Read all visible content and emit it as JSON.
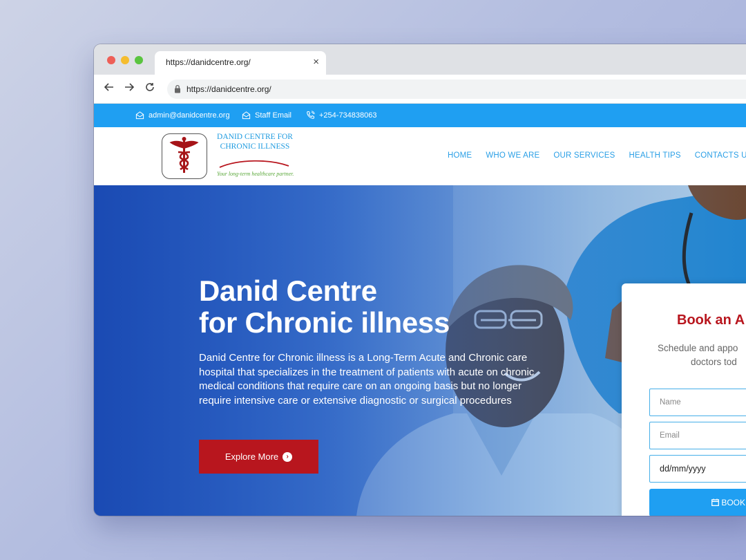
{
  "browser": {
    "tab_title": "https://danidcentre.org/",
    "tab_close": "×",
    "url": "https://danidcentre.org/"
  },
  "topbar": {
    "email": "admin@danidcentre.org",
    "staff_email": "Staff Email",
    "phone": "+254-734838063"
  },
  "logo": {
    "name_line1": "DANID CENTRE FOR",
    "name_line2": "CHRONIC ILLNESS",
    "tagline": "Your long-term healthcare partner."
  },
  "menu": [
    "HOME",
    "WHO WE ARE",
    "OUR SERVICES",
    "HEALTH TIPS",
    "CONTACTS US"
  ],
  "hero": {
    "title_line1": "Danid Centre",
    "title_line2": "for Chronic illness",
    "text": "Danid Centre for Chronic illness  is a Long-Term Acute and Chronic care hospital that  specializes in the treatment of patients with acute on chronic medical conditions that require care on an ongoing basis but no longer require intensive care or extensive diagnostic  or surgical procedures",
    "button": "Explore More"
  },
  "booking": {
    "title": "Book an A",
    "sub_line1": "Schedule and appo",
    "sub_line2": "doctors  tod",
    "name_placeholder": "Name",
    "email_placeholder": "Email",
    "date_value": "dd/mm/yyyy",
    "button": "BOOK"
  },
  "colors": {
    "accent_blue": "#1f9ff2",
    "brand_red": "#b8161e",
    "menu_blue": "#2a9fe6"
  }
}
